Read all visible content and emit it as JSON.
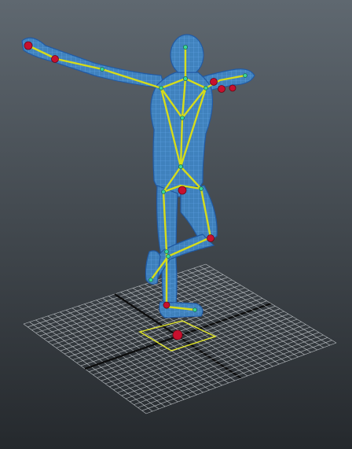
{
  "viewport": {
    "background_top": "#5f6870",
    "background_bottom": "#25292d"
  },
  "grid": {
    "line_color": "#bfc4c8",
    "axis_color": "#0c0c0c"
  },
  "rig": {
    "mesh_fill": "#3f86c6",
    "mesh_wire": "#6cb4ff",
    "mesh_outline": "#1e5aa8",
    "bone_color": "#d6dc1a",
    "bone_highlight": "#f2f57a",
    "ik_handle_color": "#c8102e",
    "joint_color": "#3cd89a",
    "selection_box_color": "#e4e82a"
  }
}
